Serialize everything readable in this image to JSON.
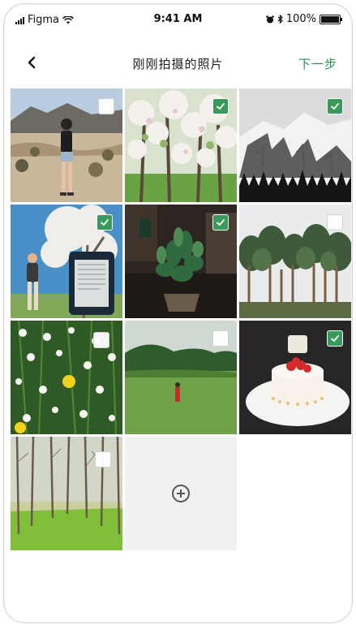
{
  "status_bar": {
    "carrier": "Figma",
    "time": "9:41 AM",
    "battery": "100%"
  },
  "nav": {
    "back_icon": "chevron-left-icon",
    "title": "刚刚拍摄的照片",
    "next_label": "下一步"
  },
  "colors": {
    "accent": "#3a9a5c",
    "next_text": "#2f8f56"
  },
  "photos": [
    {
      "subject": "woman-in-desert",
      "selected": false
    },
    {
      "subject": "blossom-orchard",
      "selected": true
    },
    {
      "subject": "snowy-mountain",
      "selected": true
    },
    {
      "subject": "man-with-ereader-blossom",
      "selected": true
    },
    {
      "subject": "potted-plant",
      "selected": true
    },
    {
      "subject": "pine-forest",
      "selected": false
    },
    {
      "subject": "daisy-flowers",
      "selected": false
    },
    {
      "subject": "person-red-dress-field",
      "selected": false
    },
    {
      "subject": "strawberry-cake",
      "selected": true
    },
    {
      "subject": "tree-rows-grass",
      "selected": false
    }
  ],
  "add_tile": {
    "icon": "add-circle-icon"
  }
}
